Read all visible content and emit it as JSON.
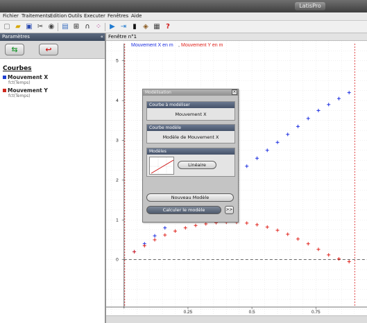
{
  "app": {
    "title": "LatisPro"
  },
  "menu": [
    "Fichier",
    "Traitements",
    "Edition",
    "Outils",
    "Executer",
    "Fenêtres",
    "Aide"
  ],
  "toolbar": {
    "icons": [
      "new-file-icon",
      "open-folder-icon",
      "save-icon",
      "scissors-icon",
      "camera-icon",
      "window-icon",
      "table-icon",
      "curve-icon",
      "plot-points-icon",
      "play-icon",
      "acquisition-icon",
      "sensor-icon",
      "stamp-icon",
      "calculator-icon",
      "help-icon"
    ]
  },
  "left_panel": {
    "title": "Paramètres",
    "collapse": "«",
    "curves_title": "Courbes",
    "curves": [
      {
        "name": "Mouvement X",
        "sub": "fct(Temps)",
        "color": "#1f3fd0"
      },
      {
        "name": "Mouvement Y",
        "sub": "fct(Temps)",
        "color": "#d02a1f"
      }
    ]
  },
  "graph_window": {
    "title": "Fenêtre n°1",
    "legend_x": "Mouvement X en m",
    "legend_sep": ",",
    "legend_y": "Mouvement Y en m",
    "colors": {
      "x": "#1d2fe0",
      "y": "#e0241d",
      "grid": "#d8d8d8",
      "axis": "#444444"
    }
  },
  "chart_data": {
    "type": "scatter",
    "xlim": [
      -0.07,
      0.95
    ],
    "ylim": [
      -1.4,
      5.5
    ],
    "x_ticks": [
      0.25,
      0.5,
      0.75
    ],
    "x_tick_labels": [
      "0.25",
      "0.5",
      "0.75"
    ],
    "y_ticks": [
      0,
      1,
      2,
      3,
      4,
      5
    ],
    "y_tick_labels": [
      "0",
      "1",
      "2",
      "3",
      "4",
      "5"
    ],
    "cursor_x": [
      0.0,
      0.9
    ],
    "series": [
      {
        "name": "Mouvement X",
        "color": "#1d2fe0",
        "x": [
          0.04,
          0.08,
          0.12,
          0.16,
          0.2,
          0.24,
          0.28,
          0.32,
          0.36,
          0.4,
          0.44,
          0.48,
          0.52,
          0.56,
          0.6,
          0.64,
          0.68,
          0.72,
          0.76,
          0.8,
          0.84,
          0.88
        ],
        "y": [
          0.2,
          0.4,
          0.6,
          0.8,
          1.0,
          1.2,
          1.4,
          1.6,
          1.8,
          2.0,
          2.15,
          2.35,
          2.55,
          2.75,
          2.95,
          3.15,
          3.35,
          3.55,
          3.75,
          3.9,
          4.05,
          4.2
        ]
      },
      {
        "name": "Mouvement Y",
        "color": "#e0241d",
        "x": [
          0.04,
          0.08,
          0.12,
          0.16,
          0.2,
          0.24,
          0.28,
          0.32,
          0.36,
          0.4,
          0.44,
          0.48,
          0.52,
          0.56,
          0.6,
          0.64,
          0.68,
          0.72,
          0.76,
          0.8,
          0.84,
          0.88
        ],
        "y": [
          0.2,
          0.35,
          0.5,
          0.62,
          0.72,
          0.8,
          0.86,
          0.9,
          0.93,
          0.94,
          0.94,
          0.92,
          0.88,
          0.82,
          0.74,
          0.64,
          0.52,
          0.4,
          0.26,
          0.12,
          0.02,
          -0.05
        ]
      }
    ]
  },
  "dialog": {
    "title": "Modélisation",
    "close": "×",
    "sec1_title": "Courbe à modéliser",
    "sec1_value": "Mouvement X",
    "sec2_title": "Courbe modèle",
    "sec2_value": "Modèle de Mouvement X",
    "sec3_title": "Modèles",
    "model_button": "Linéaire",
    "new_model_button": "Nouveau Modèle",
    "compute_button": "Calculer le modèle",
    "expand_button": ">>"
  }
}
